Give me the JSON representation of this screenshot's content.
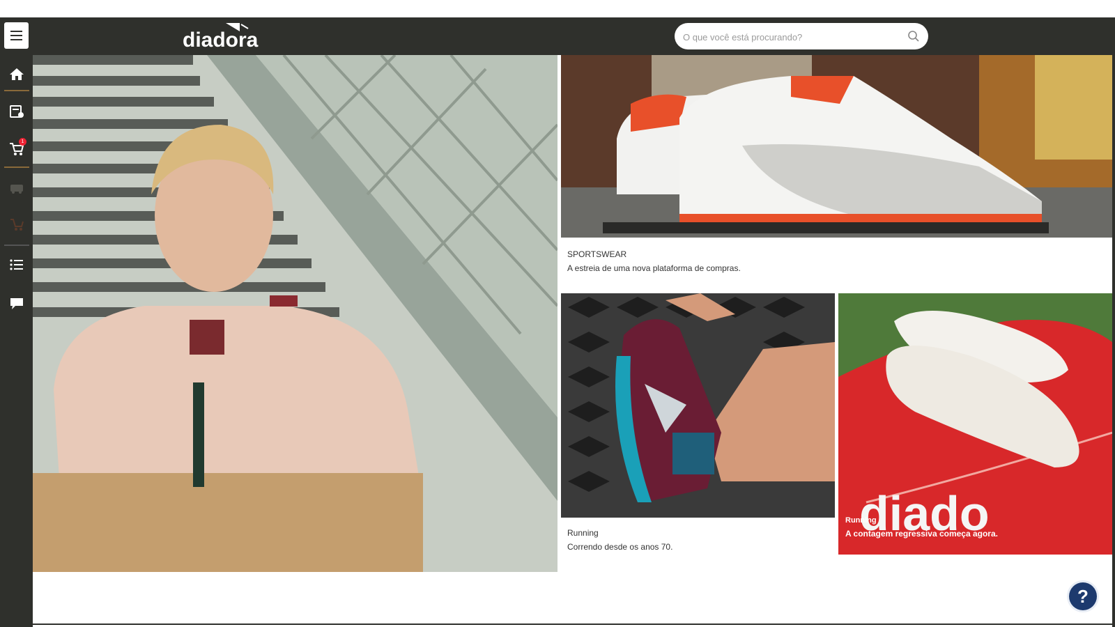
{
  "header": {
    "logo_text": "diadora",
    "search_placeholder": "O que você está procurando?"
  },
  "sidebar": {
    "items": [
      {
        "icon": "home-icon"
      },
      {
        "icon": "order-icon"
      },
      {
        "icon": "cart-icon",
        "badge": "1"
      },
      {
        "icon": "truck-icon"
      },
      {
        "icon": "cart-arrow-icon"
      },
      {
        "icon": "list-icon"
      },
      {
        "icon": "chat-icon"
      }
    ]
  },
  "tiles": {
    "sportswear": {
      "category": "SPORTSWEAR",
      "description": "A estreia de uma nova plataforma de compras."
    },
    "running": {
      "category": "Running",
      "description": "Correndo desde os anos 70."
    },
    "football": {
      "category": "Running",
      "description": "A contagem regressiva começa agora."
    }
  },
  "help": {
    "label": "?"
  },
  "colors": {
    "bar": "#2f302c",
    "accent": "#e8502a",
    "help": "#1d3a6e"
  }
}
